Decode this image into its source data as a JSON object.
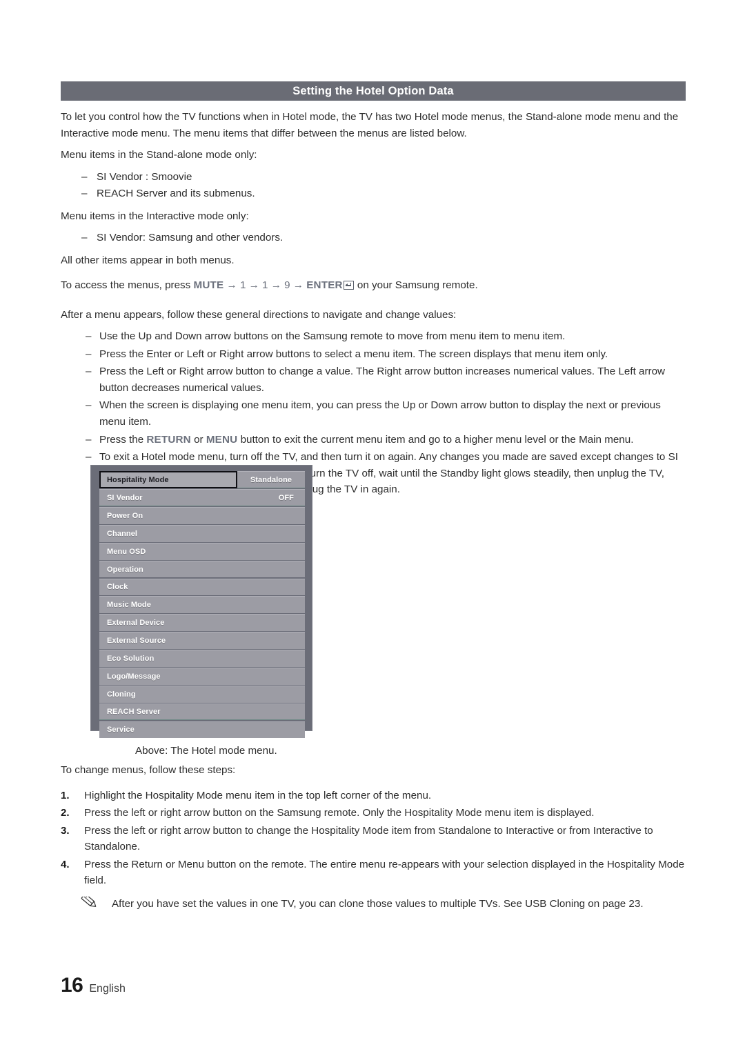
{
  "header": {
    "title": "Setting the Hotel Option Data"
  },
  "body": {
    "intro": "To let you control how the TV functions when in Hotel mode, the TV has two Hotel mode menus, the Stand-alone mode menu and the Interactive mode menu. The menu items that differ between the menus are listed below.",
    "standalone_lead": "Menu items in the Stand-alone mode only:",
    "standalone_items": [
      "SI Vendor : Smoovie",
      "REACH Server and its submenus."
    ],
    "interactive_lead": "Menu items in the Interactive mode only:",
    "interactive_items": [
      "SI Vendor: Samsung and other vendors."
    ],
    "both_note": "All other items appear in both menus.",
    "access": {
      "prefix": "To access the menus, press ",
      "key_mute": "MUTE",
      "arrow": "→",
      "key_1a": "1",
      "key_1b": "1",
      "key_9": "9",
      "key_enter": "ENTER",
      "suffix": " on your Samsung remote."
    },
    "after_menu_lead": "After a menu appears, follow these general directions to navigate and change values:",
    "directions": [
      "Use the Up and Down arrow buttons on the Samsung remote to move from menu item to menu item.",
      "Press the Enter or Left or Right arrow buttons to select a menu item. The screen displays that menu item only.",
      "Press the Left or Right arrow button to change a value. The Right arrow button increases numerical values. The Left arrow button decreases numerical values.",
      "When the screen is displaying one menu item, you can press the Up or Down arrow button to display the next or previous menu item.",
      "To exit a Hotel mode menu, turn off the TV, and then turn it on again. Any changes you made are saved except changes to SI Vendor. For changes to SI Vendor, you must turn the TV off, wait until the Standby light glows steadily, then unplug the TV, wait for the Standby light to go off, and then plug the TV in again."
    ],
    "return_bullet": {
      "pre": "Press the ",
      "key_return": "RETURN",
      "mid": " or ",
      "key_menu": "MENU",
      "post": " button to exit the current menu item and go to a higher menu level or the Main menu."
    },
    "caption": "Above: The Hotel mode menu.",
    "steps_lead": "To change menus, follow these steps:",
    "steps": [
      {
        "num": "1.",
        "text": "Highlight the Hospitality Mode menu item in the top left corner of the menu."
      },
      {
        "num": "2.",
        "text": "Press the left or right arrow button on the Samsung remote. Only the Hospitality Mode menu item is displayed."
      },
      {
        "num": "3.",
        "text": "Press the left or right arrow button to change the Hospitality Mode item from Standalone to Interactive or from Interactive to Standalone."
      },
      {
        "num": "4.",
        "text": "Press the Return or Menu button on the remote. The entire menu re-appears with your selection displayed in the Hospitality Mode field."
      }
    ],
    "note": "After you have set the values in one TV, you can clone those values to multiple TVs. See USB Cloning on page 23."
  },
  "tv_menu": {
    "selected_label": "Hospitality Mode",
    "selected_value": "Standalone",
    "rows": [
      {
        "label": "SI Vendor",
        "value": "OFF"
      },
      {
        "label": "Power On",
        "value": ""
      },
      {
        "label": "Channel",
        "value": ""
      },
      {
        "label": "Menu OSD",
        "value": ""
      },
      {
        "label": "Operation",
        "value": ""
      },
      {
        "label": "Clock",
        "value": ""
      },
      {
        "label": "Music Mode",
        "value": ""
      },
      {
        "label": "External Device",
        "value": ""
      },
      {
        "label": "External Source",
        "value": ""
      },
      {
        "label": "Eco Solution",
        "value": ""
      },
      {
        "label": "Logo/Message",
        "value": ""
      },
      {
        "label": "Cloning",
        "value": ""
      },
      {
        "label": "REACH Server",
        "value": ""
      },
      {
        "label": "Service",
        "value": ""
      }
    ]
  },
  "footer": {
    "page_number": "16",
    "language": "English"
  },
  "colors": {
    "header_bar": "#6a6c75",
    "key_accent": "#6b707c",
    "menu_bg": "#6b6d78",
    "menu_row": "#9c9ca4"
  }
}
